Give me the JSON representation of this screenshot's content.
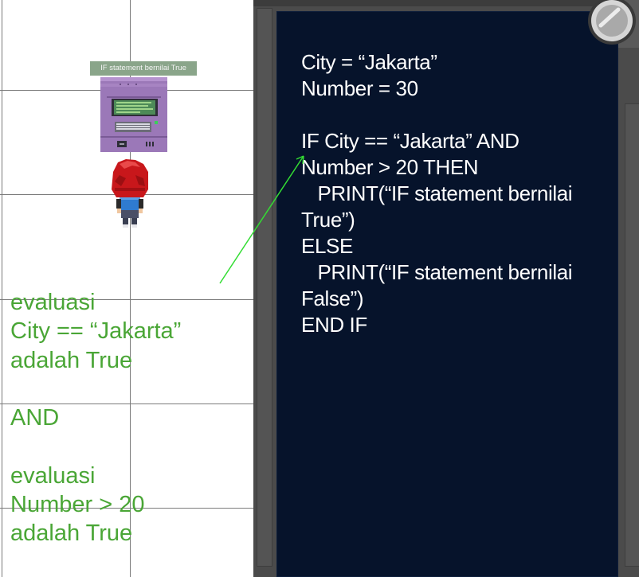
{
  "game": {
    "terminal_label": "IF statement bernilai True",
    "evaluation_notes": [
      "evaluasi",
      "City == “Jakarta”",
      "adalah True",
      "",
      "AND",
      "",
      "evaluasi",
      "Number > 20",
      "adalah True"
    ]
  },
  "code_panel": {
    "lines": [
      "City = “Jakarta”",
      "Number = 30",
      "",
      "IF City == “Jakarta” AND",
      "Number > 20 THEN",
      "   PRINT(“IF statement bernilai",
      "True”)",
      "ELSE",
      "   PRINT(“IF statement bernilai",
      "False”)",
      "END IF"
    ]
  },
  "colors": {
    "code_panel_bg": "#06132b",
    "code_text": "#ffffff",
    "note_text": "#4aa636",
    "label_bg": "#8aa58a",
    "room_bg": "#4b4b4b"
  },
  "icons": [
    "computer-terminal-icon",
    "player-character-icon",
    "magnifier-icon",
    "pointer-arrow"
  ]
}
